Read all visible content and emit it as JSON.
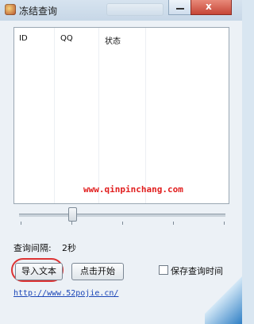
{
  "window": {
    "title": "冻结查询",
    "close_glyph": "x"
  },
  "list": {
    "columns": [
      "ID",
      "QQ",
      "状态"
    ],
    "watermark": "www.qinpinchang.com"
  },
  "interval": {
    "label": "查询间隔:",
    "value": "2秒"
  },
  "buttons": {
    "import_label": "导入文本",
    "start_label": "点击开始"
  },
  "save_time": {
    "label": "保存查询时间",
    "checked": false
  },
  "link": "http://www.52pojie.cn/",
  "colors": {
    "watermark": "#e11d1d",
    "highlight": "#d33333",
    "link": "#1b46b7"
  },
  "icons": {
    "app": "app-icon",
    "minimize": "minimize-icon",
    "close": "close-icon"
  }
}
